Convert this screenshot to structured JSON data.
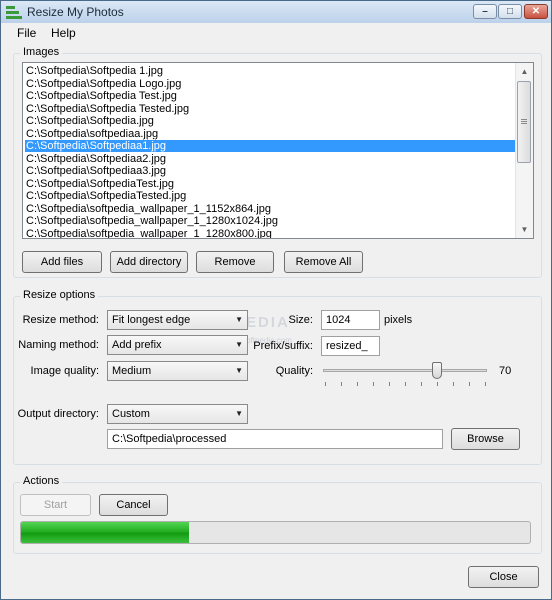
{
  "window": {
    "title": "Resize My Photos"
  },
  "menu": [
    "File",
    "Help"
  ],
  "images": {
    "group_label": "Images",
    "files": [
      "C:\\Softpedia\\Softpedia 1.jpg",
      "C:\\Softpedia\\Softpedia Logo.jpg",
      "C:\\Softpedia\\Softpedia Test.jpg",
      "C:\\Softpedia\\Softpedia Tested.jpg",
      "C:\\Softpedia\\Softpedia.jpg",
      "C:\\Softpedia\\softpediaa.jpg",
      "C:\\Softpedia\\Softpediaa1.jpg",
      "C:\\Softpedia\\Softpediaa2.jpg",
      "C:\\Softpedia\\Softpediaa3.jpg",
      "C:\\Softpedia\\SoftpediaTest.jpg",
      "C:\\Softpedia\\SoftpediaTested.jpg",
      "C:\\Softpedia\\softpedia_wallpaper_1_1152x864.jpg",
      "C:\\Softpedia\\softpedia_wallpaper_1_1280x1024.jpg",
      "C:\\Softpedia\\softpedia_wallpaper_1_1280x800.jpg"
    ],
    "selected_index": 6,
    "buttons": {
      "add_files": "Add files",
      "add_directory": "Add directory",
      "remove": "Remove",
      "remove_all": "Remove All"
    }
  },
  "resize_options": {
    "group_label": "Resize options",
    "resize_method_label": "Resize method:",
    "resize_method": "Fit longest edge",
    "size_label": "Size:",
    "size_value": "1024",
    "size_unit": "pixels",
    "naming_method_label": "Naming method:",
    "naming_method": "Add prefix",
    "prefix_label": "Prefix/suffix:",
    "prefix_value": "resized_",
    "image_quality_label": "Image quality:",
    "image_quality": "Medium",
    "quality_label": "Quality:",
    "quality_value": "70",
    "output_directory_label": "Output directory:",
    "output_directory": "Custom",
    "output_path": "C:\\Softpedia\\processed",
    "browse": "Browse"
  },
  "actions": {
    "group_label": "Actions",
    "start": "Start",
    "cancel": "Cancel",
    "progress_fraction": 0.33
  },
  "close": "Close",
  "watermark": {
    "big": "SOFTPEDIA",
    "small": "www.softpedia.com"
  }
}
